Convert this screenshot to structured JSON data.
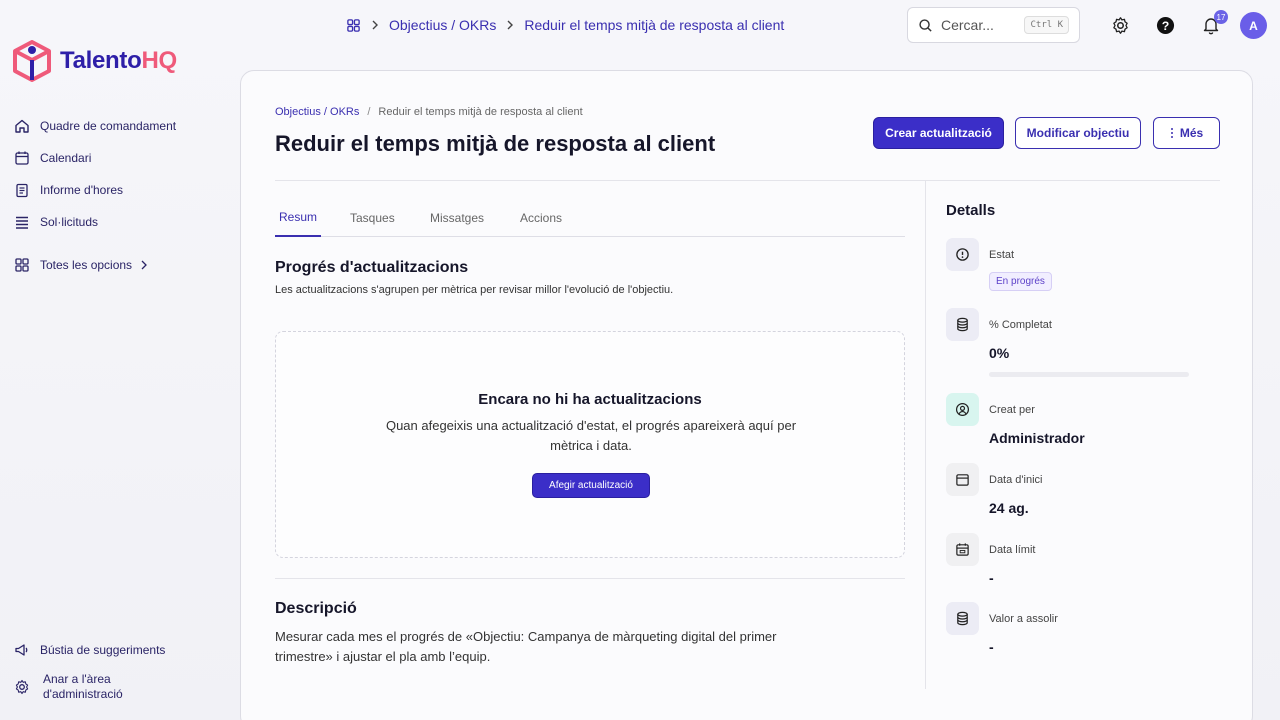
{
  "app": {
    "logo_part1": "Talento",
    "logo_part2": "HQ"
  },
  "colors": {
    "accent": "#3b2ec8",
    "brand_pink": "#ef5a7a",
    "brand_navy": "#2e1fa8"
  },
  "sidebar": {
    "items": [
      {
        "label": "Quadre de comandament",
        "icon": "home-icon"
      },
      {
        "label": "Calendari",
        "icon": "calendar-icon"
      },
      {
        "label": "Informe d'hores",
        "icon": "clipboard-icon"
      },
      {
        "label": "Sol·licituds",
        "icon": "list-icon"
      }
    ],
    "all_options": "Totes les opcions",
    "bottom": [
      {
        "label": "Bústia de suggeriments",
        "icon": "megaphone-icon"
      },
      {
        "label": "Anar a l'àrea d'administració",
        "line1": "Anar a l'àrea",
        "line2": "d'administració",
        "icon": "gear-icon"
      }
    ]
  },
  "topbar": {
    "crumb1": "Objectius / OKRs",
    "crumb2": "Reduir el temps mitjà de resposta al client",
    "search_placeholder": "Cercar...",
    "search_shortcut": "Ctrl K",
    "notifications_count": "17",
    "avatar_initial": "A"
  },
  "page": {
    "breadcrumb_link": "Objectius / OKRs",
    "breadcrumb_sep": "/",
    "breadcrumb_current": "Reduir el temps mitjà de resposta al client",
    "title": "Reduir el temps mitjà de resposta al client",
    "actions": {
      "create": "Crear actualització",
      "edit": "Modificar objectiu",
      "more": "Més"
    },
    "tabs": [
      "Resum",
      "Tasques",
      "Missatges",
      "Accions"
    ],
    "active_tab": "Resum",
    "progress_title": "Progrés d'actualitzacions",
    "progress_desc": "Les actualitzacions s'agrupen per mètrica per revisar millor l'evolució de l'objectiu.",
    "empty_title": "Encara no hi ha actualitzacions",
    "empty_desc": "Quan afegeixis una actualització d'estat, el progrés apareixerà aquí per mètrica i data.",
    "empty_button": "Afegir actualització",
    "description_title": "Descripció",
    "description_text": "Mesurar cada mes el progrés de «Objectiu: Campanya de màrqueting digital del primer trimestre» i ajustar el pla amb l’equip."
  },
  "details": {
    "title": "Detalls",
    "status_label": "Estat",
    "status_value": "En progrés",
    "completion_label": "% Completat",
    "completion_value": "0%",
    "completion_fraction": 0,
    "created_by_label": "Creat per",
    "created_by_value": "Administrador",
    "start_label": "Data d'inici",
    "start_value": "24 ag.",
    "due_label": "Data límit",
    "due_value": "-",
    "target_label": "Valor a assolir",
    "target_value": "-"
  }
}
